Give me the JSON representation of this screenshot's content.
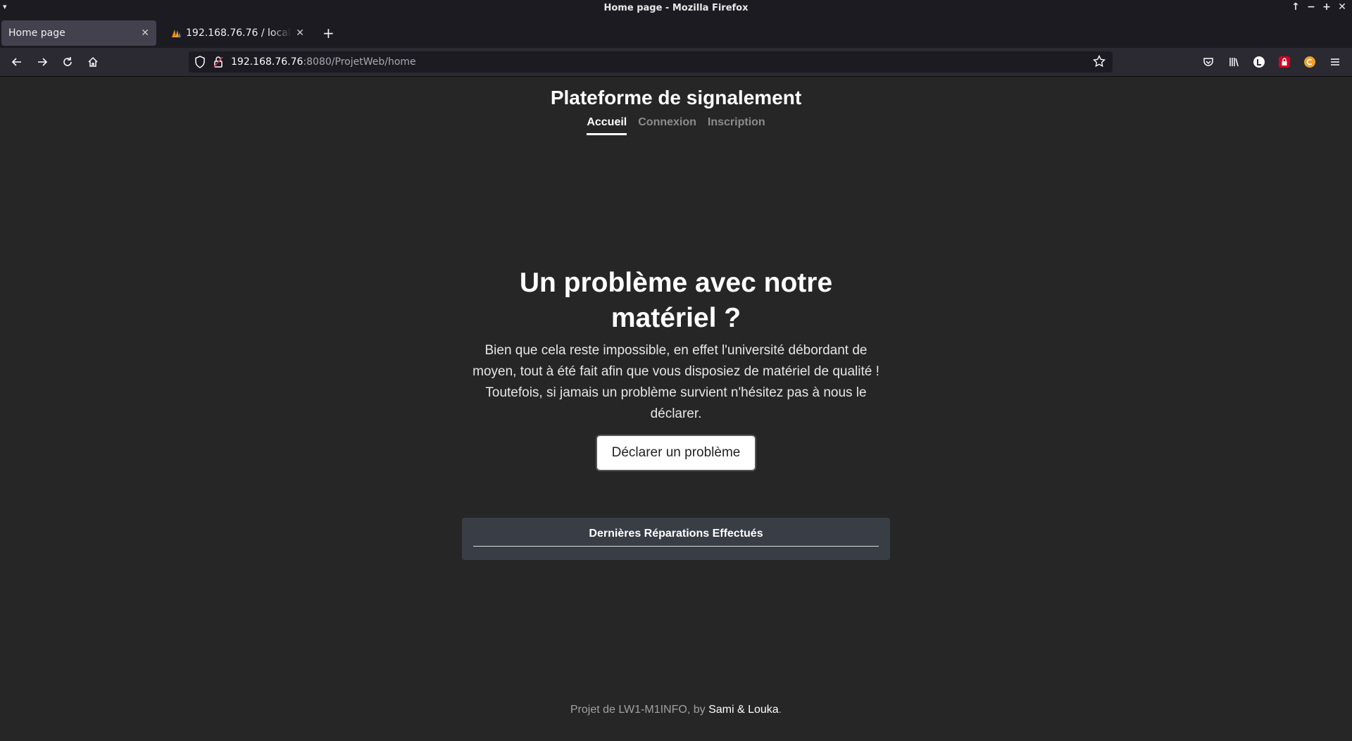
{
  "window": {
    "title": "Home page - Mozilla Firefox"
  },
  "tabs": [
    {
      "label": "Home page",
      "active": true
    },
    {
      "label": "192.168.76.76 / localhost",
      "active": false
    }
  ],
  "urlbar": {
    "host": "192.168.76.76",
    "path": ":8080/ProjetWeb/home"
  },
  "site": {
    "title": "Plateforme de signalement",
    "nav": [
      {
        "label": "Accueil",
        "current": true
      },
      {
        "label": "Connexion",
        "current": false
      },
      {
        "label": "Inscription",
        "current": false
      }
    ]
  },
  "hero": {
    "title": "Un problème avec notre matériel ?",
    "text": "Bien que cela reste impossible, en effet l'université débordant de moyen, tout à été fait afin que vous disposiez de matériel de qualité ! Toutefois, si jamais un problème survient n'hésitez pas à nous le déclarer.",
    "button": "Déclarer un problème"
  },
  "repairs": {
    "title": "Dernières Réparations Effectués"
  },
  "footer": {
    "prefix": "Projet de LW1-M1INFO, by ",
    "authors": "Sami & Louka",
    "suffix": "."
  },
  "colors": {
    "page_bg": "#262626",
    "card_bg": "#393d45",
    "browser_chrome": "#1c1b22",
    "toolbar": "#2b2a33"
  },
  "icons": {
    "back": "arrow-left-icon",
    "forward": "arrow-right-icon",
    "reload": "reload-icon",
    "home": "home-icon",
    "shield": "shield-icon",
    "lock": "lock-icon",
    "bookmark": "star-icon",
    "pocket": "pocket-icon",
    "library": "library-icon",
    "menu": "hamburger-icon"
  }
}
